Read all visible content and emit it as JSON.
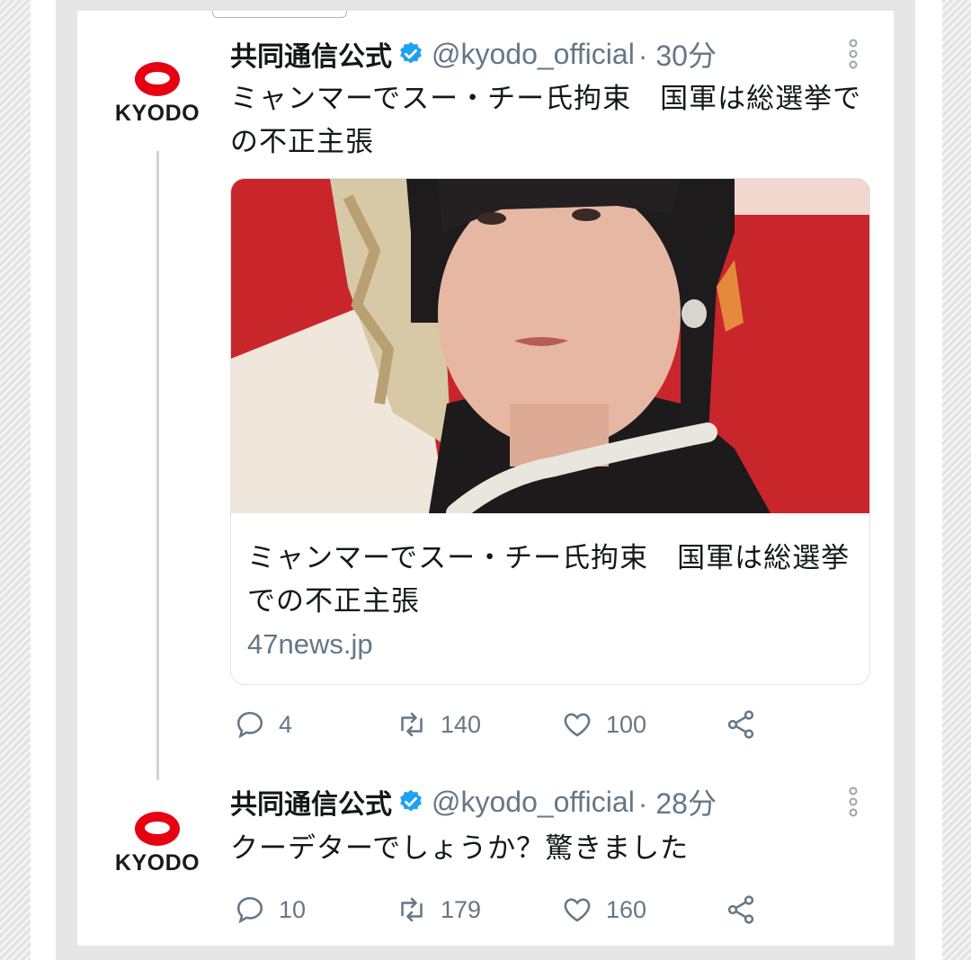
{
  "tweets": [
    {
      "avatar_text": "KYODO",
      "name": "共同通信公式",
      "handle": "@kyodo_official",
      "time": "· 30分",
      "text": "ミャンマーでスー・チー氏拘束　国軍は総選挙での不正主張",
      "card": {
        "title": "ミャンマーでスー・チー氏拘束　国軍は総選挙での不正主張",
        "domain": "47news.jp"
      },
      "replies": "4",
      "retweets": "140",
      "likes": "100"
    },
    {
      "avatar_text": "KYODO",
      "name": "共同通信公式",
      "handle": "@kyodo_official",
      "time": "· 28分",
      "text": "クーデターでしょうか？驚きました",
      "replies": "10",
      "retweets": "179",
      "likes": "160"
    }
  ],
  "icons": {
    "verified": "verified-badge-icon",
    "more": "more-vertical-icon",
    "reply": "reply-icon",
    "retweet": "retweet-icon",
    "like": "heart-icon",
    "share": "share-icon"
  },
  "colors": {
    "brand_red": "#e60012",
    "verified_blue": "#1da1f2",
    "muted": "#657786",
    "text": "#14171a"
  }
}
